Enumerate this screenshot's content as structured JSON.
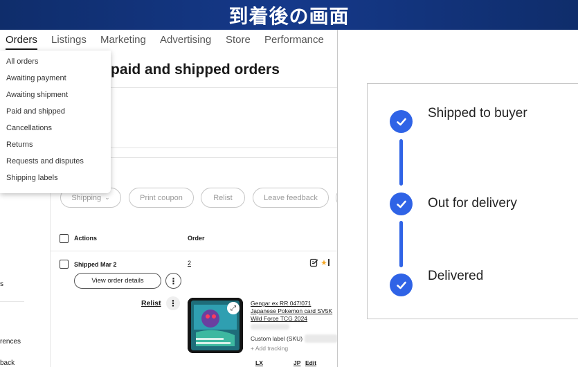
{
  "banner": {
    "title": "到着後の画面"
  },
  "nav": {
    "items": [
      {
        "label": "Orders"
      },
      {
        "label": "Listings"
      },
      {
        "label": "Marketing"
      },
      {
        "label": "Advertising"
      },
      {
        "label": "Store"
      },
      {
        "label": "Performance"
      }
    ],
    "active": "Orders"
  },
  "page": {
    "title": "paid and shipped orders"
  },
  "dropdown": {
    "items": [
      "All orders",
      "Awaiting payment",
      "Awaiting shipment",
      "Paid and shipped",
      "Cancellations",
      "Returns",
      "Requests and disputes",
      "Shipping labels"
    ]
  },
  "filters": {
    "shipping": "Shipping",
    "print_coupon": "Print coupon",
    "relist": "Relist",
    "leave_feedback": "Leave feedback"
  },
  "table": {
    "header_actions": "Actions",
    "header_order": "Order"
  },
  "order": {
    "status": "Shipped Mar 2",
    "qty": "2",
    "view_details": "View order details",
    "relist": "Relist",
    "item_title": "Gengar ex RR 047/071 Japanese Pokemon card SV5K Wild Force TCG 2024",
    "custom_label": "Custom label (SKU)",
    "add_tracking": "+ Add tracking",
    "carrier": "LX",
    "country": "JP",
    "edit": "Edit"
  },
  "sidebar_fragments": {
    "a": "s",
    "b": "rences",
    "c": "back"
  },
  "tracker": {
    "steps": [
      {
        "label": "Shipped to buyer"
      },
      {
        "label": "Out for delivery"
      },
      {
        "label": "Delivered"
      }
    ],
    "color": "#2f63e6"
  },
  "colors": {
    "banner": "#15398a",
    "accent": "#2f63e6"
  }
}
